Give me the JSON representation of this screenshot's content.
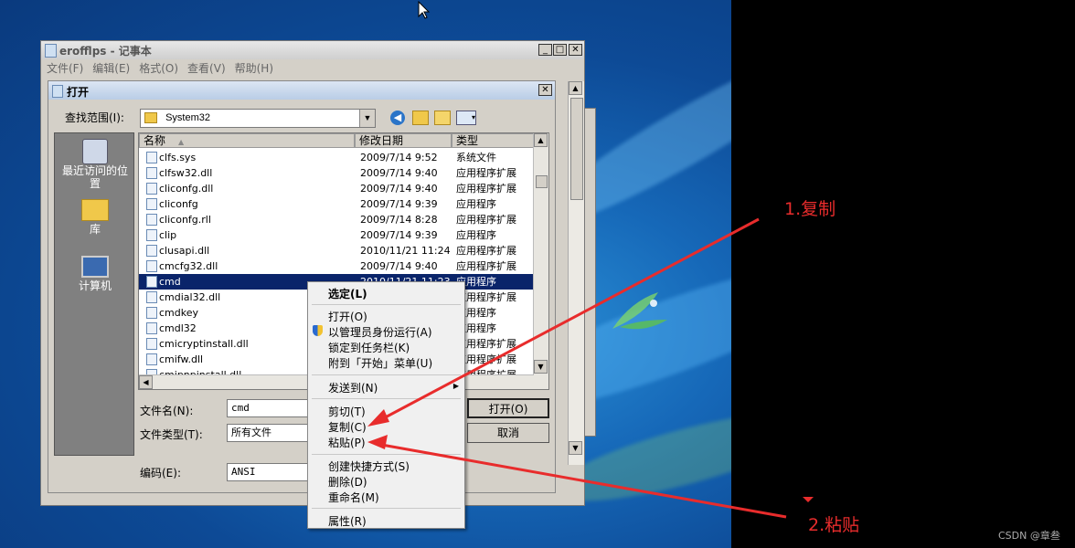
{
  "notepad": {
    "title": "erofflps - 记事本",
    "menu": [
      "文件(F)",
      "编辑(E)",
      "格式(O)",
      "查看(V)",
      "帮助(H)"
    ]
  },
  "dialog": {
    "title": "打开",
    "look_in_label": "查找范围(I):",
    "look_in_value": "System32",
    "places": [
      "最近访问的位置",
      "库",
      "计算机"
    ],
    "columns": [
      "名称",
      "修改日期",
      "类型"
    ],
    "files": [
      {
        "name": "clfs.sys",
        "date": "2009/7/14 9:52",
        "type": "系统文件"
      },
      {
        "name": "clfsw32.dll",
        "date": "2009/7/14 9:40",
        "type": "应用程序扩展"
      },
      {
        "name": "cliconfg.dll",
        "date": "2009/7/14 9:40",
        "type": "应用程序扩展"
      },
      {
        "name": "cliconfg",
        "date": "2009/7/14 9:39",
        "type": "应用程序"
      },
      {
        "name": "cliconfg.rll",
        "date": "2009/7/14 8:28",
        "type": "应用程序扩展"
      },
      {
        "name": "clip",
        "date": "2009/7/14 9:39",
        "type": "应用程序"
      },
      {
        "name": "clusapi.dll",
        "date": "2010/11/21 11:24",
        "type": "应用程序扩展"
      },
      {
        "name": "cmcfg32.dll",
        "date": "2009/7/14 9:40",
        "type": "应用程序扩展"
      },
      {
        "name": "cmd",
        "date": "2010/11/21 11:23",
        "type": "应用程序"
      },
      {
        "name": "cmdial32.dll",
        "date": "",
        "type": "应用程序扩展"
      },
      {
        "name": "cmdkey",
        "date": "",
        "type": "应用程序"
      },
      {
        "name": "cmdl32",
        "date": "",
        "type": "应用程序"
      },
      {
        "name": "cmicryptinstall.dll",
        "date": "",
        "type": "应用程序扩展"
      },
      {
        "name": "cmifw.dll",
        "date": "",
        "type": "应用程序扩展"
      },
      {
        "name": "cmipnpinstall.dll",
        "date": "",
        "type": "应用程序扩展"
      }
    ],
    "selected_index": 8,
    "filename_label": "文件名(N):",
    "filename_value": "cmd",
    "filetype_label": "文件类型(T):",
    "filetype_value": "所有文件",
    "encoding_label": "编码(E):",
    "encoding_value": "ANSI",
    "open_button": "打开(O)",
    "cancel_button": "取消"
  },
  "context_menu": {
    "items": [
      "选定(L)",
      "打开(O)",
      "以管理员身份运行(A)",
      "锁定到任务栏(K)",
      "附到「开始」菜单(U)",
      "发送到(N)",
      "剪切(T)",
      "复制(C)",
      "粘贴(P)",
      "创建快捷方式(S)",
      "删除(D)",
      "重命名(M)",
      "属性(R)"
    ]
  },
  "annotations": {
    "copy": "1.复制",
    "paste": "2.粘贴",
    "color": "#e82c2c"
  },
  "watermark": "CSDN @章叁"
}
